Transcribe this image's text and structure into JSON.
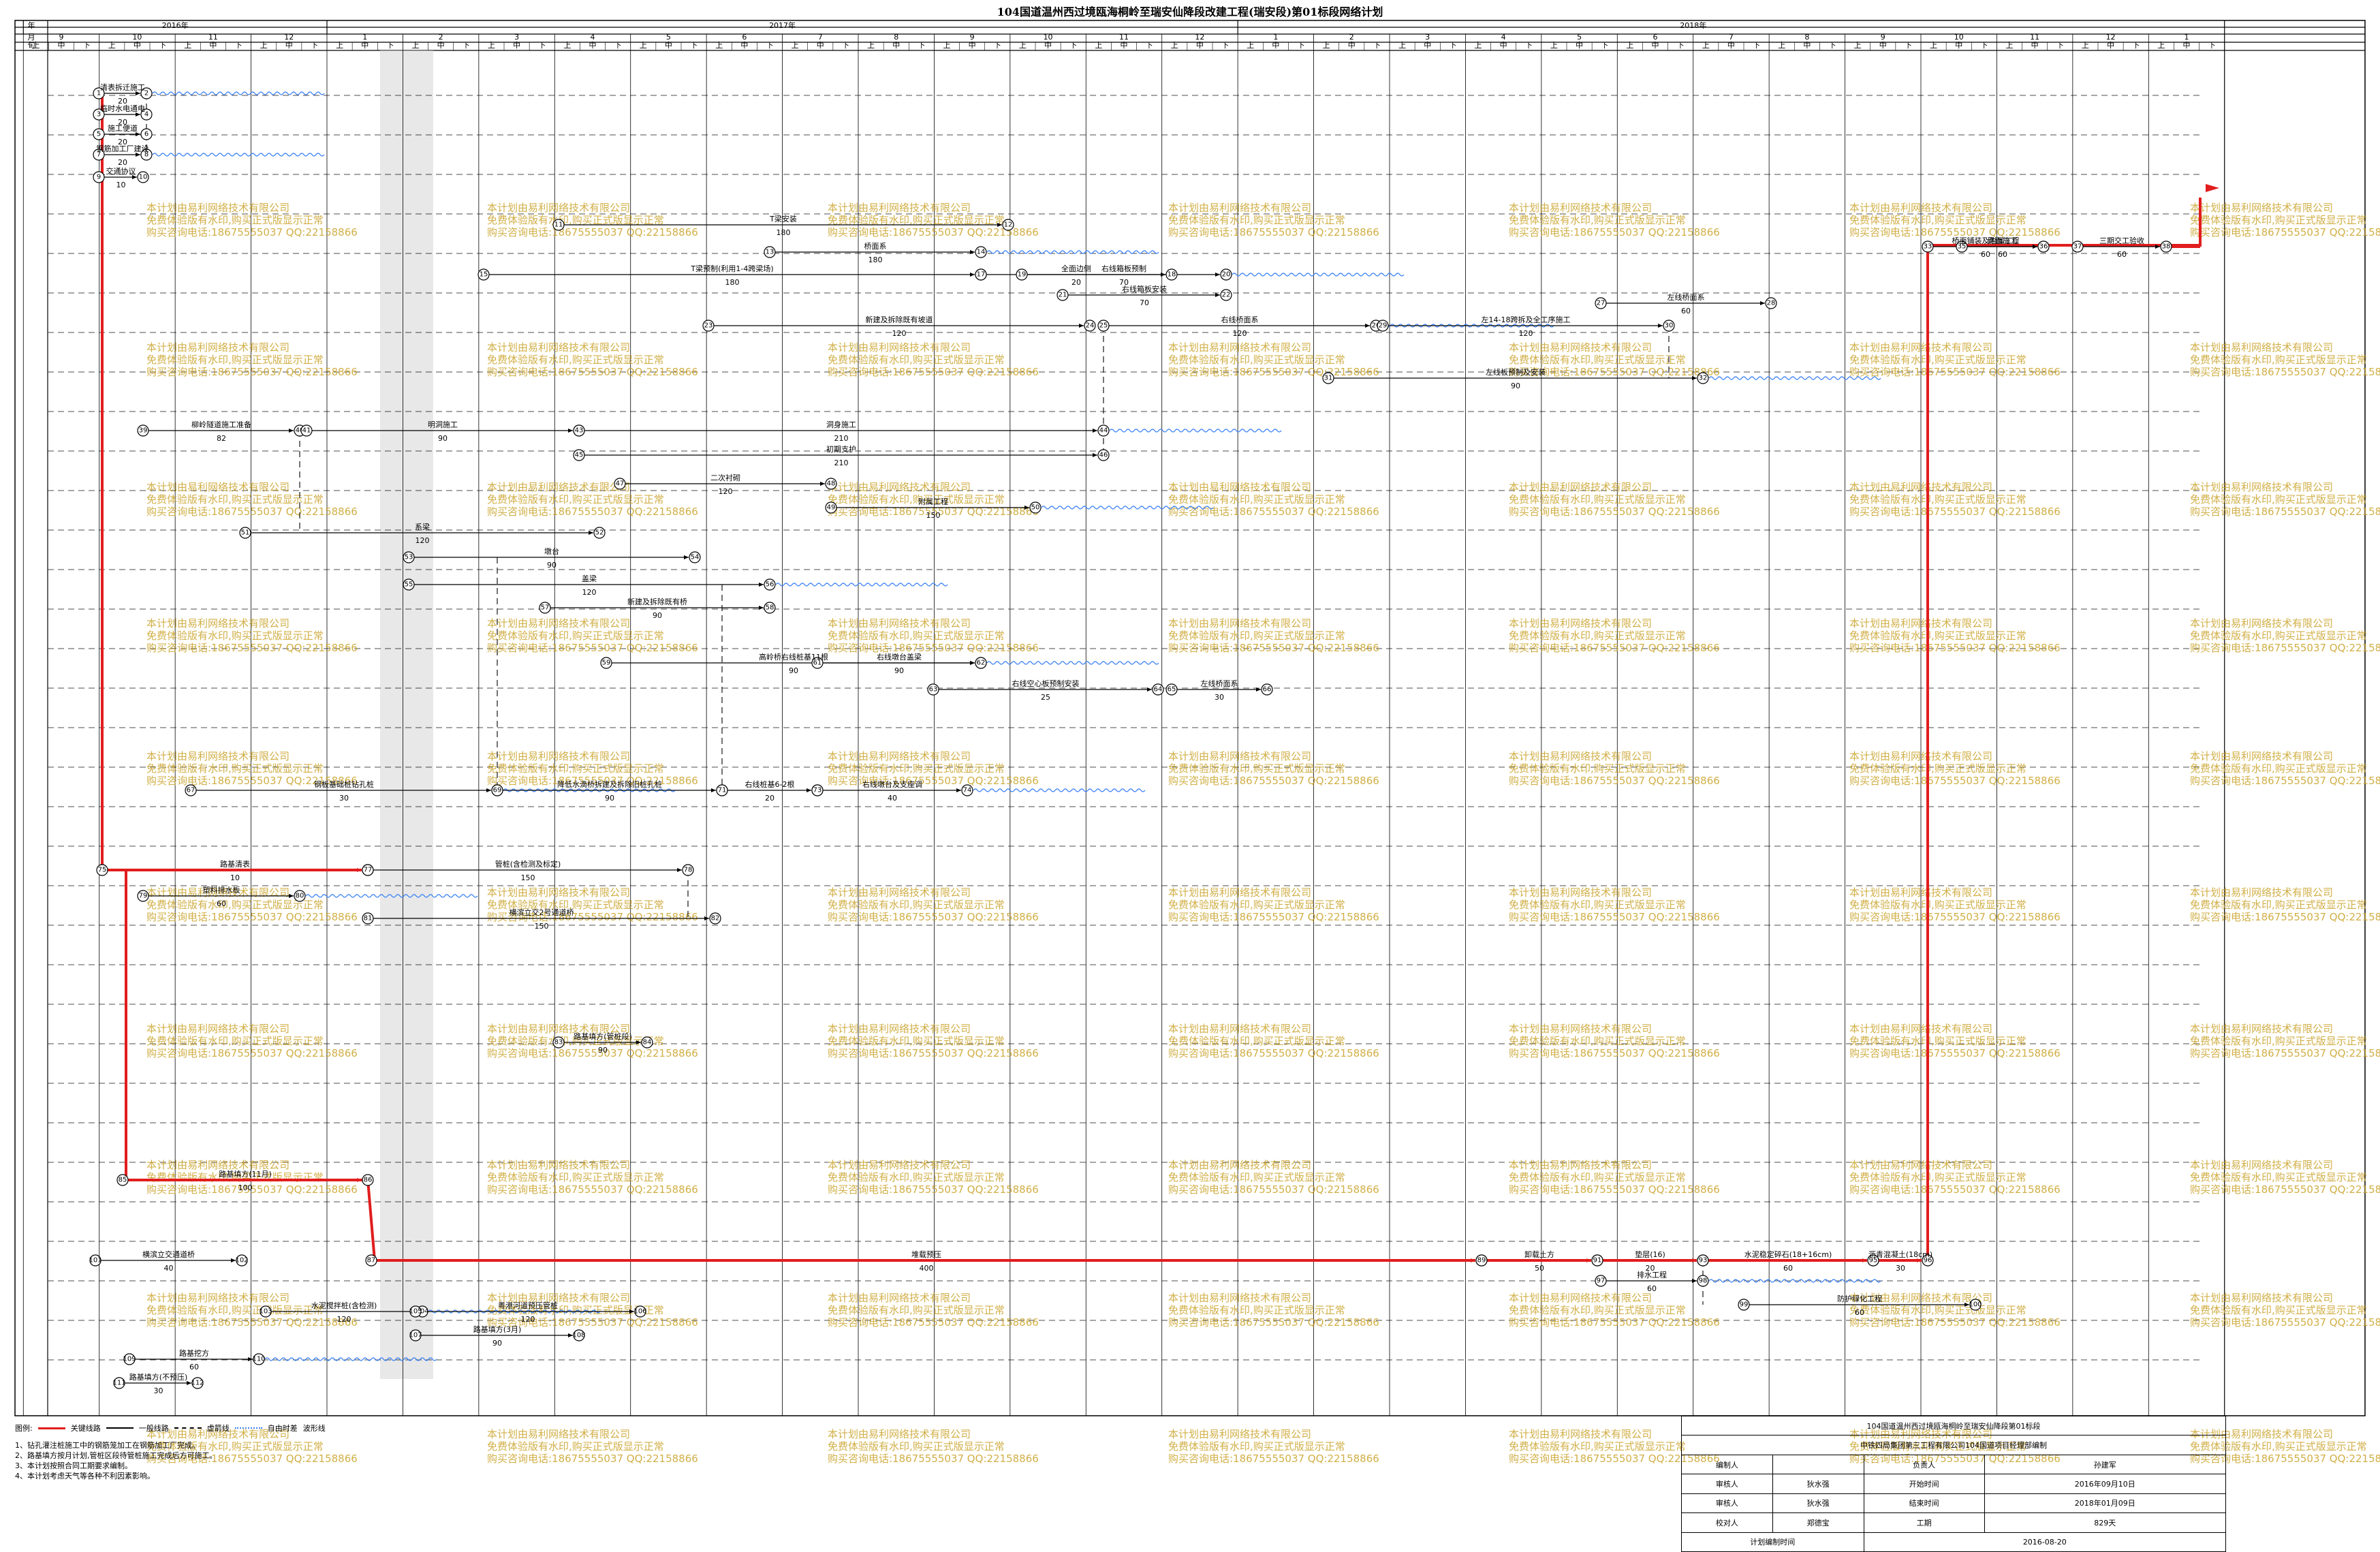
{
  "title": "104国道温州西过境瓯海桐岭至瑞安仙降段改建工程(瑞安段)第01标段网络计划",
  "header": {
    "year_label": "年",
    "month_label": "月",
    "ten_day_label": "旬",
    "years": [
      "2016年",
      "2017年",
      "2018年"
    ],
    "months": [
      "9",
      "10",
      "11",
      "12",
      "1",
      "2",
      "3",
      "4",
      "5",
      "6",
      "7",
      "8",
      "9",
      "10",
      "11",
      "12",
      "1",
      "2",
      "3",
      "4",
      "5",
      "6",
      "7",
      "8",
      "9",
      "10",
      "11",
      "12",
      "1"
    ],
    "ten_days": [
      "上",
      "中",
      "下"
    ]
  },
  "tasks": [
    {
      "label": "清表拆迁施工",
      "dur": "20"
    },
    {
      "label": "临时水电通电",
      "dur": "20"
    },
    {
      "label": "施工便道",
      "dur": "20"
    },
    {
      "label": "钢筋加工厂建设",
      "dur": "20"
    },
    {
      "label": "交通协议",
      "dur": "10"
    },
    {
      "label": "T梁安装",
      "dur": "180"
    },
    {
      "label": "桥面系",
      "dur": "180"
    },
    {
      "label": "T梁预制(利用1-4跨梁场)",
      "dur": "180"
    },
    {
      "label": "全面边侧",
      "dur": "20"
    },
    {
      "label": "右线箱板预制",
      "dur": "70"
    },
    {
      "label": "右线箱板安装",
      "dur": "70"
    },
    {
      "label": "新建及拆除既有坡道",
      "dur": "120"
    },
    {
      "label": "右线桥面系",
      "dur": "120"
    },
    {
      "label": "左线桥面系",
      "dur": "60"
    },
    {
      "label": "左14-18跨拆及全工序施工",
      "dur": "120"
    },
    {
      "label": "左线板预制及安装",
      "dur": "90"
    },
    {
      "label": "桥面铺装及附属工程",
      "dur": "60"
    },
    {
      "label": "路面施工",
      "dur": "60"
    },
    {
      "label": "三期交工验收",
      "dur": "60"
    },
    {
      "label": "柳岭隧道施工准备",
      "dur": "82"
    },
    {
      "label": "明洞施工",
      "dur": "90"
    },
    {
      "label": "洞身施工",
      "dur": "210"
    },
    {
      "label": "初期支护",
      "dur": "210"
    },
    {
      "label": "二次衬砌",
      "dur": "120"
    },
    {
      "label": "附属工程",
      "dur": "150"
    },
    {
      "label": "系梁",
      "dur": "120"
    },
    {
      "label": "墩台",
      "dur": "90"
    },
    {
      "label": "盖梁",
      "dur": "120"
    },
    {
      "label": "新建及拆除既有桥",
      "dur": "90"
    },
    {
      "label": "高岭桥右线桩基11根",
      "dur": "90"
    },
    {
      "label": "右线墩台盖梁",
      "dur": "90"
    },
    {
      "label": "右线空心板预制安装",
      "dur": "25"
    },
    {
      "label": "左线桥面系",
      "dur": "30"
    },
    {
      "label": "钢板基础桩钻孔桩",
      "dur": "30"
    },
    {
      "label": "降低水滴桥拆建及拆除旧桩孔桩",
      "dur": "90"
    },
    {
      "label": "右线桩基6-2根",
      "dur": "20"
    },
    {
      "label": "右线墩台及支座调",
      "dur": "40"
    },
    {
      "label": "路基清表",
      "dur": "10"
    },
    {
      "label": "管桩(含检测及标定)",
      "dur": "150"
    },
    {
      "label": "塑料排水板",
      "dur": "60"
    },
    {
      "label": "横滨立交2号通道桥",
      "dur": "150"
    },
    {
      "label": "路基填方(管桩段)",
      "dur": "90"
    },
    {
      "label": "路基填方(11月)",
      "dur": "100"
    },
    {
      "label": "堆载预压",
      "dur": "400"
    },
    {
      "label": "卸载土方",
      "dur": "50"
    },
    {
      "label": "垫层(16)",
      "dur": "20"
    },
    {
      "label": "水泥稳定碎石(18+16cm)",
      "dur": "60"
    },
    {
      "label": "沥青混凝土(18cm)",
      "dur": "30"
    },
    {
      "label": "排水工程",
      "dur": "60"
    },
    {
      "label": "防护绿化工程",
      "dur": "60"
    },
    {
      "label": "横滨立交通道桥",
      "dur": "40"
    },
    {
      "label": "水泥搅拌桩(含检测)",
      "dur": "120"
    },
    {
      "label": "粤港河道预压管桩",
      "dur": "120"
    },
    {
      "label": "路基填方(3月)",
      "dur": "90"
    },
    {
      "label": "路基挖方",
      "dur": "60"
    },
    {
      "label": "路基填方(不预压)",
      "dur": "30"
    }
  ],
  "watermark": [
    "本计划由易利网络技术有限公司",
    "免费体验版有水印,购买正式版显示正常",
    "购买咨询电话:18675555037 QQ:22158866"
  ],
  "legend": {
    "title": "图例:",
    "items": [
      "关键线路",
      "一般线路",
      "虚箭线",
      "自由时差",
      "波形线"
    ],
    "notes": [
      "1、钻孔灌注桩施工中的钢筋笼加工在钢筋加工厂完成。",
      "2、路基填方按月计划,管桩区段待管桩施工完成后方可施工。",
      "3、本计划按照合同工期要求编制。",
      "4、本计划考虑天气等各种不利因素影响。"
    ]
  },
  "info": {
    "project": "104国道温州西过境瓯海桐岭至瑞安仙降段第01标段",
    "company": "中铁四局集团第三工程有限公司104国道项目经理部编制",
    "rows": [
      [
        "编制人",
        "",
        "负责人",
        "孙建军"
      ],
      [
        "审核人",
        "狄水强",
        "开始时间",
        "2016年09月10日"
      ],
      [
        "审核人",
        "狄水强",
        "结束时间",
        "2018年01月09日"
      ],
      [
        "校对人",
        "郑德宝",
        "工期",
        "829天"
      ]
    ],
    "footer_label": "计划编制时间",
    "footer_value": "2016-08-20"
  }
}
